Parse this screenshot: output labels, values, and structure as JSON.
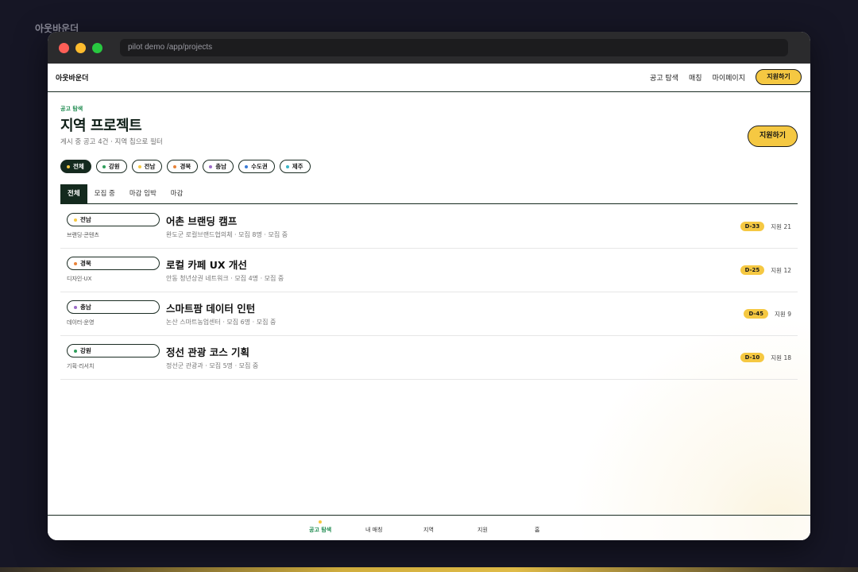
{
  "outer_brand": "아웃바운더",
  "browser": {
    "url": "pilot demo /app/projects"
  },
  "topnav": {
    "logo": "아웃바운더",
    "links": [
      "공고 탐색",
      "매칭",
      "마이페이지"
    ],
    "apply_label": "지원하기"
  },
  "header": {
    "kicker": "공고 탐색",
    "title": "지역 프로젝트",
    "subtitle": "게시 중 공고 4건 · 지역 칩으로 필터",
    "apply_label": "지원하기"
  },
  "chips": [
    {
      "label": "전체",
      "color": "#f5c842",
      "active": true
    },
    {
      "label": "강원",
      "color": "#2f9e5b"
    },
    {
      "label": "전남",
      "color": "#f5c842"
    },
    {
      "label": "경북",
      "color": "#e8833a"
    },
    {
      "label": "충남",
      "color": "#9b6bc7"
    },
    {
      "label": "수도권",
      "color": "#3a7bd5"
    },
    {
      "label": "제주",
      "color": "#3ab5c7"
    }
  ],
  "tabs": [
    "전체",
    "모집 중",
    "마감 임박",
    "마감"
  ],
  "projects": [
    {
      "region": "전남",
      "region_color": "#f5c842",
      "category": "브랜딩·콘텐츠",
      "title": "어촌 브랜딩 캠프",
      "meta": "완도군 로컬브랜드협의체 · 모집 8명 · 모집 중",
      "dday": "D-33",
      "applicants": "지원 21"
    },
    {
      "region": "경북",
      "region_color": "#e8833a",
      "category": "디자인·UX",
      "title": "로컬 카페 UX 개선",
      "meta": "안동 청년상권 네트워크 · 모집 4명 · 모집 중",
      "dday": "D-25",
      "applicants": "지원 12"
    },
    {
      "region": "충남",
      "region_color": "#9b6bc7",
      "category": "데이터·운영",
      "title": "스마트팜 데이터 인턴",
      "meta": "논산 스마트농업센터 · 모집 6명 · 모집 중",
      "dday": "D-45",
      "applicants": "지원 9"
    },
    {
      "region": "강원",
      "region_color": "#2f9e5b",
      "category": "기획·리서치",
      "title": "정선 관광 코스 기획",
      "meta": "정선군 관광과 · 모집 5명 · 모집 중",
      "dday": "D-10",
      "applicants": "지원 18"
    }
  ],
  "bottomnav": [
    "공고 탐색",
    "내 매칭",
    "지역",
    "지원",
    "홈"
  ],
  "colors": {
    "accent": "#f5c842",
    "dark": "#142a1e",
    "green": "#1d8a4e"
  }
}
